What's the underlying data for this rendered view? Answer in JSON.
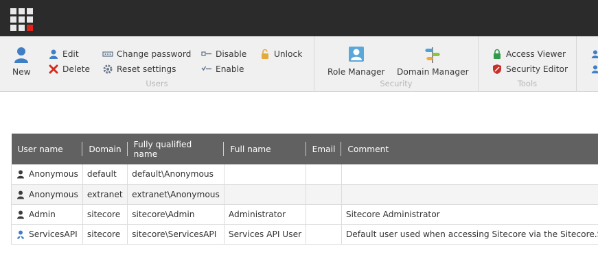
{
  "ribbon": {
    "users": {
      "title": "Users",
      "new_label": "New",
      "edit_label": "Edit",
      "delete_label": "Delete",
      "change_password_label": "Change password",
      "reset_settings_label": "Reset settings",
      "disable_label": "Disable",
      "enable_label": "Enable",
      "unlock_label": "Unlock"
    },
    "security": {
      "title": "Security",
      "role_manager_label": "Role Manager",
      "domain_manager_label": "Domain Manager"
    },
    "tools": {
      "title": "Tools",
      "access_viewer_label": "Access Viewer",
      "security_editor_label": "Security Editor"
    }
  },
  "table": {
    "columns": [
      "User name",
      "Domain",
      "Fully qualified name",
      "Full name",
      "Email",
      "Comment"
    ],
    "rows": [
      {
        "user": "Anonymous",
        "domain": "default",
        "fqn": "default\\Anonymous",
        "fullname": "",
        "email": "",
        "comment": "",
        "icon": "user-icon"
      },
      {
        "user": "Anonymous",
        "domain": "extranet",
        "fqn": "extranet\\Anonymous",
        "fullname": "",
        "email": "",
        "comment": "",
        "icon": "user-icon"
      },
      {
        "user": "Admin",
        "domain": "sitecore",
        "fqn": "sitecore\\Admin",
        "fullname": "Administrator",
        "email": "",
        "comment": "Sitecore Administrator",
        "icon": "user-icon"
      },
      {
        "user": "ServicesAPI",
        "domain": "sitecore",
        "fqn": "sitecore\\ServicesAPI",
        "fullname": "Services API User",
        "email": "",
        "comment": "Default user used when accessing Sitecore via the Sitecore.Serv",
        "icon": "api-user-icon"
      }
    ]
  },
  "colors": {
    "topbar": "#2b2b2b",
    "header": "#616161",
    "accent_red": "#e2231a",
    "user_blue": "#3f7fc6"
  }
}
